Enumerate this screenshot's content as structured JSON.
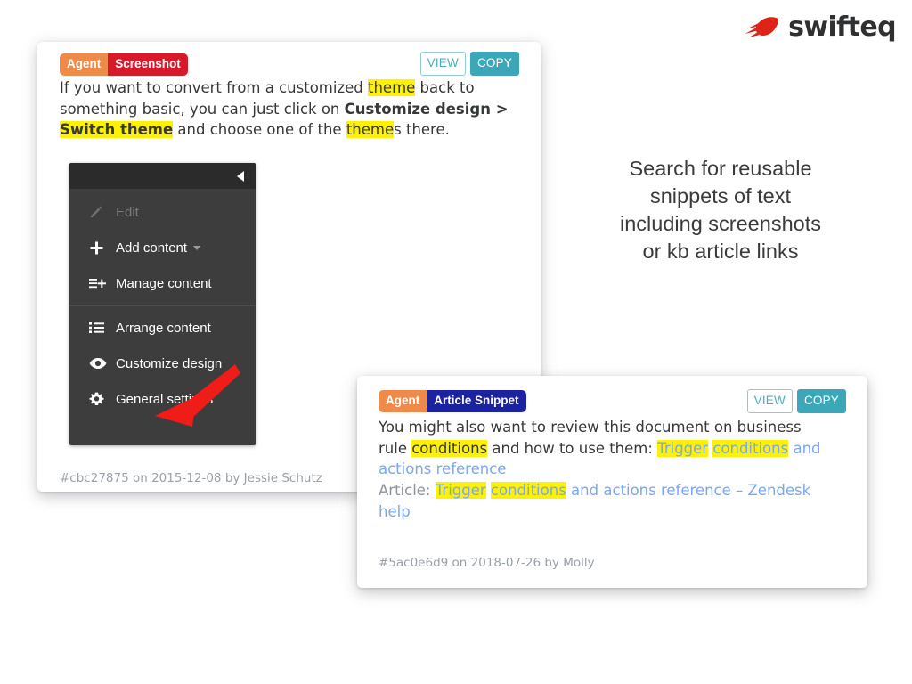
{
  "brand": {
    "name": "swifteq",
    "logo_icon": "swifteq-comet-mark",
    "color": "#e02318"
  },
  "caption": {
    "lines": [
      "Search for reusable",
      "snippets of text",
      "including screenshots",
      "or kb article links"
    ]
  },
  "cards": {
    "screenshot": {
      "badge_agent": "Agent",
      "badge_type": "Screenshot",
      "view_label": "VIEW",
      "copy_label": "COPY",
      "text": {
        "p1_a": "If you want to convert from a customized ",
        "p1_hl1": "theme",
        "p1_b": " back to something basic, you can just click on ",
        "p1_bold1": "Customize design >",
        "p1_c": " ",
        "p1_boldhl": "Switch theme",
        "p1_d": " and choose one of the ",
        "p1_hl2": "theme",
        "p1_e": "s there."
      },
      "panel": {
        "collapse_icon": "collapse-left-arrow",
        "items": [
          {
            "label": "Edit",
            "icon": "pencil-icon",
            "disabled": true
          },
          {
            "label": "Add content",
            "icon": "plus-icon",
            "disabled": false,
            "caret": true
          },
          {
            "label": "Manage content",
            "icon": "list-plus-icon",
            "disabled": false
          },
          {
            "label": "Arrange content",
            "icon": "list-icon",
            "disabled": false
          },
          {
            "label": "Customize design",
            "icon": "eye-icon",
            "disabled": false
          },
          {
            "label": "General settings",
            "icon": "gear-icon",
            "disabled": false
          }
        ]
      },
      "annotation_icon": "red-arrow-pointing-to-customize-design",
      "footer": "#cbc27875 on 2015-12-08 by Jessie Schutz"
    },
    "article": {
      "badge_agent": "Agent",
      "badge_type": "Article Snippet",
      "view_label": "VIEW",
      "copy_label": "COPY",
      "text": {
        "p1_a": "You might also want to review this document on business rule ",
        "p1_hl1": "conditions",
        "p1_b": " and how to use them: ",
        "p1_link_hl1": "Trigger",
        "p1_link_sp": " ",
        "p1_link_hl2": "conditions",
        "p1_link_tail": " and actions reference",
        "p2_prefix": "Article: ",
        "p2_hl1": "Trigger",
        "p2_sp": " ",
        "p2_hl2": "conditions",
        "p2_tail": " and actions reference – Zendesk help"
      },
      "footer": "#5ac0e6d9 on 2018-07-26 by Molly"
    }
  }
}
